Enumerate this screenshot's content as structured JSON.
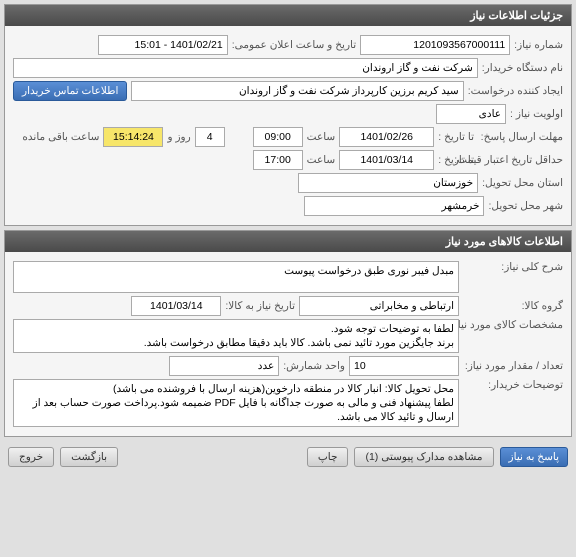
{
  "panel1": {
    "title": "جزئیات اطلاعات نیاز",
    "req_no_label": "شماره نیاز:",
    "req_no": "1201093567000111",
    "pub_date_label": "تاریخ و ساعت اعلان عمومی:",
    "pub_date": "1401/02/21 - 15:01",
    "buyer_label": "نام دستگاه خریدار:",
    "buyer": "شرکت نفت و گاز اروندان",
    "creator_label": "ایجاد کننده درخواست:",
    "creator": "سید کریم برزین کارپرداز شرکت نفت و گاز اروندان",
    "contact_btn": "اطلاعات تماس خریدار",
    "priority_label": "اولویت نیاز :",
    "priority": "عادی",
    "deadline_label": "مهلت ارسال پاسخ:",
    "to_date_label": "تا تاریخ :",
    "deadline_date": "1401/02/26",
    "time_label": "ساعت",
    "deadline_time": "09:00",
    "days": "4",
    "days_and": "روز و",
    "remaining_time": "15:14:24",
    "remaining_label": "ساعت باقی مانده",
    "min_validity_label": "حداقل تاریخ اعتبار قیمت:",
    "validity_date": "1401/03/14",
    "validity_time": "17:00",
    "province_label": "استان محل تحویل:",
    "province": "خوزستان",
    "city_label": "شهر محل تحویل:",
    "city": "خرمشهر"
  },
  "panel2": {
    "title": "اطلاعات کالاهای مورد نیاز",
    "desc_label": "شرح کلی نیاز:",
    "desc": "مبدل فیبر نوری طبق درخواست پیوست",
    "group_label": "گروه کالا:",
    "group": "ارتباطی و مخابراتی",
    "needed_date_label": "تاریخ نیاز به کالا:",
    "needed_date": "1401/03/14",
    "spec_label": "مشخصات کالای مورد نیاز:",
    "spec": "لطفا به توضیحات توجه شود.\nبرند جایگزین مورد تائید نمی باشد. کالا باید دقیقا مطابق درخواست باشد.",
    "qty_label": "تعداد / مقدار مورد نیاز:",
    "qty": "10",
    "unit_label": "واحد شمارش:",
    "unit": "عدد",
    "buyer_notes_label": "توضیحات خریدار:",
    "buyer_notes": "محل تحویل کالا: انبار کالا در منطقه دارخوین(هزینه ارسال با فروشنده می باشد)\nلطفا پیشنهاد فنی و مالی به صورت جداگانه با فایل PDF ضمیمه شود.پرداخت صورت حساب بعد از ارسال و تائید کالا می باشد."
  },
  "footer": {
    "respond": "پاسخ به نیاز",
    "attachments": "مشاهده مدارک پیوستی (1)",
    "print": "چاپ",
    "back": "بازگشت",
    "exit": "خروج"
  }
}
